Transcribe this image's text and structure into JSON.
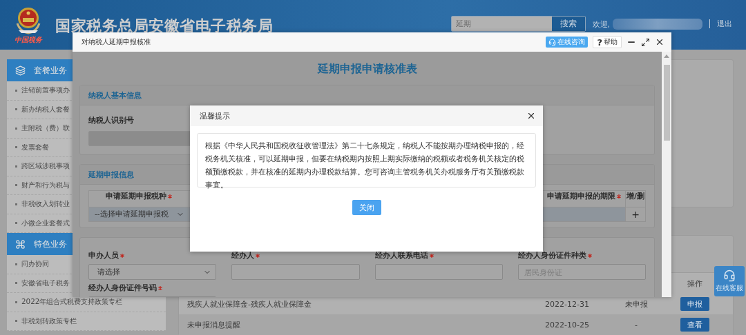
{
  "header": {
    "site_title": "国家税务总局安徽省电子税务局",
    "logo_caption": "中国税务",
    "search": {
      "value": "延期",
      "button": "搜索"
    },
    "welcome": "欢迎,",
    "logout": "退出"
  },
  "sidebar": {
    "sections": [
      {
        "title": "套餐业务",
        "items": [
          "注销前置事项办",
          "新办纳税人套餐",
          "主附税（费）联",
          "发票套餐",
          "跨区域涉税事项",
          "财产和行为税与",
          "非税收入划转业",
          "小微企业套餐式"
        ]
      },
      {
        "title": "特色业务",
        "items": [
          "问办协同",
          "安徽省电子税务",
          "2022年组合式税费支持政策专栏",
          "非税划转政策专栏"
        ]
      }
    ]
  },
  "tasks": {
    "action_header": "操作",
    "rows": [
      {
        "name": "残疾人就业保障金-残疾人就业保障金",
        "date": "2022-12-31",
        "status": "未申报",
        "action": "申报"
      },
      {
        "name": "未申报消息提醒",
        "date": "2022-10-25",
        "status": "-",
        "action": "查看"
      }
    ]
  },
  "support_button": "在线客服",
  "dialog": {
    "title": "对纳税人延期申报核准",
    "consult_button": "在线咨询",
    "help_mark": "?",
    "help_button": "帮助",
    "form": {
      "title": "延期申报申请核准表",
      "basic_info": {
        "title": "纳税人基本信息",
        "taxpayer_id_label": "纳税人识别号"
      },
      "extension": {
        "title": "延期申报信息",
        "columns": [
          {
            "label": "申请延期申报税种",
            "required": true
          },
          {
            "label": "申请延期申报的期限",
            "required": true
          },
          {
            "label": "增/删",
            "required": false
          }
        ],
        "tax_type_select": "--选择申请延期申报税",
        "add_mark": "+"
      },
      "applicant_fields": [
        {
          "label": "申办人员",
          "required": true,
          "kind": "select",
          "value": "请选择"
        },
        {
          "label": "经办人",
          "required": true,
          "kind": "input"
        },
        {
          "label": "经办人联系电话",
          "required": true,
          "kind": "input"
        },
        {
          "label": "经办人身份证件种类",
          "required": true,
          "kind": "input",
          "placeholder": "居民身份证"
        },
        {
          "label": "经办人身份证件号码",
          "required": true,
          "kind": "input"
        }
      ]
    }
  },
  "alert": {
    "title": "温馨提示",
    "message": "根据《中华人民共和国税收征收管理法》第二十七条规定，纳税人不能按期办理纳税申报的，经税务机关核准，可以延期申报，但要在纳税期内按照上期实际缴纳的税额或者税务机关核定的税额预缴税款，并在核准的延期内办理税款结算。您可咨询主管税务机关办税服务厅有关预缴税款事宜。",
    "button": "关闭"
  }
}
